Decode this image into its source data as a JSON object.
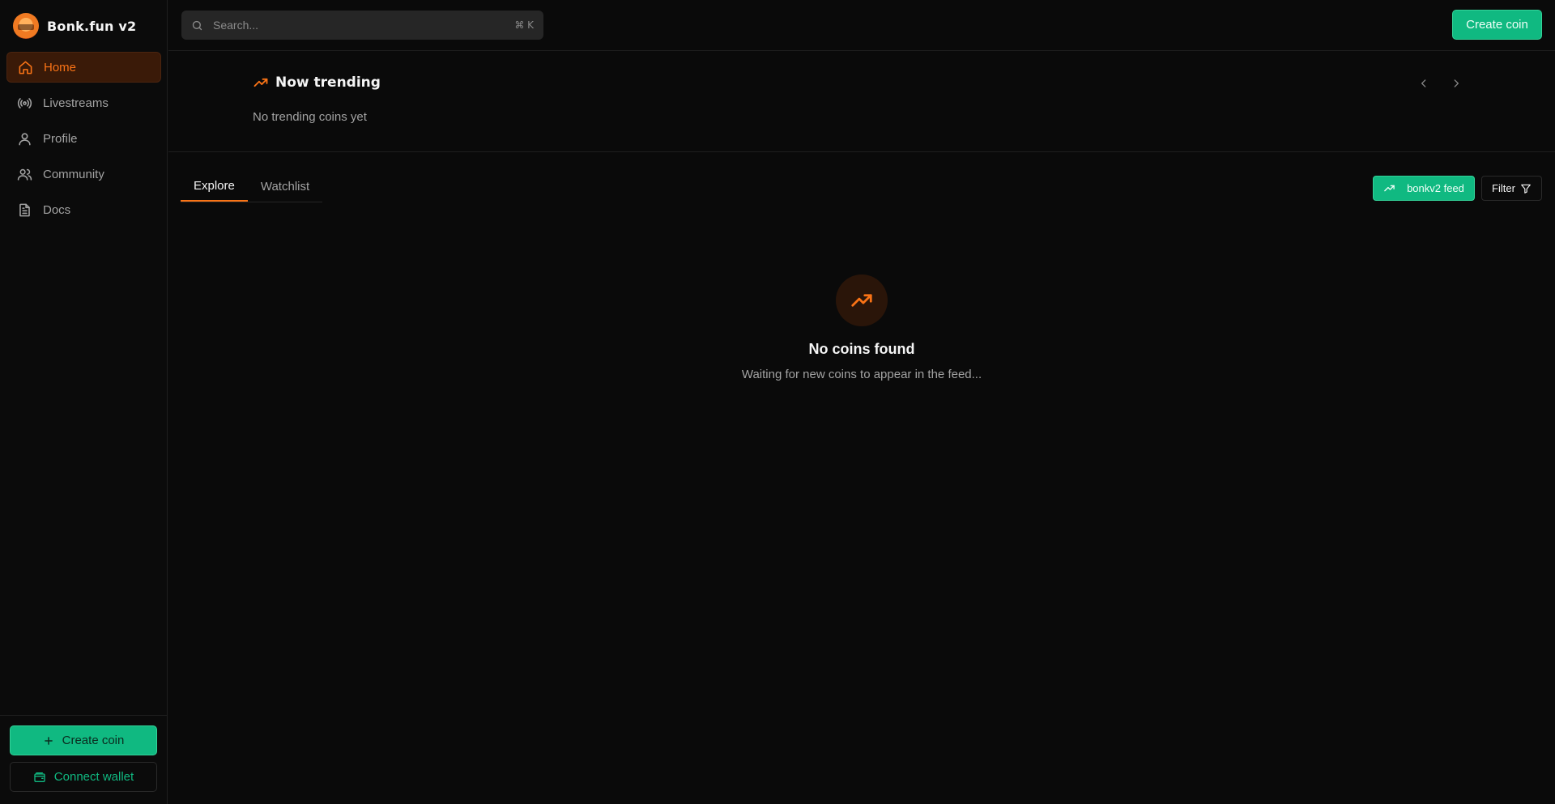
{
  "brand": {
    "name": "Bonk.fun v2"
  },
  "sidebar": {
    "items": [
      {
        "label": "Home",
        "icon": "home-icon",
        "active": true
      },
      {
        "label": "Livestreams",
        "icon": "broadcast-icon"
      },
      {
        "label": "Profile",
        "icon": "user-icon"
      },
      {
        "label": "Community",
        "icon": "users-icon"
      },
      {
        "label": "Docs",
        "icon": "document-icon"
      }
    ],
    "create_label": "Create coin",
    "connect_label": "Connect wallet"
  },
  "search": {
    "placeholder": "Search...",
    "shortcut": "⌘ K"
  },
  "header": {
    "create_label": "Create coin"
  },
  "trending": {
    "title": "Now trending",
    "empty": "No trending coins yet"
  },
  "tabs": [
    {
      "label": "Explore",
      "active": true
    },
    {
      "label": "Watchlist"
    }
  ],
  "feed": {
    "label": "bonkv2 feed"
  },
  "filter": {
    "label": "Filter"
  },
  "empty_state": {
    "title": "No coins found",
    "subtitle": "Waiting for new coins to appear in the feed..."
  },
  "colors": {
    "accent": "#f97316",
    "primary": "#10b981",
    "background": "#0a0a0a"
  }
}
